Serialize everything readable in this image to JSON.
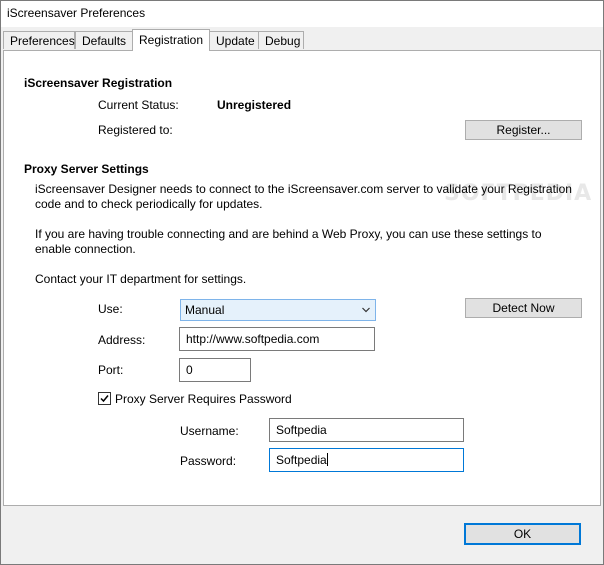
{
  "window": {
    "title": "iScreensaver Preferences"
  },
  "tabs": [
    {
      "label": "Preferences"
    },
    {
      "label": "Defaults"
    },
    {
      "label": "Registration"
    },
    {
      "label": "Update"
    },
    {
      "label": "Debug"
    }
  ],
  "active_tab": "Registration",
  "registration": {
    "heading": "iScreensaver Registration",
    "status_label": "Current Status:",
    "status_value": "Unregistered",
    "registered_to_label": "Registered to:",
    "register_button": "Register..."
  },
  "proxy": {
    "heading": "Proxy Server Settings",
    "desc_line1": "iScreensaver Designer needs to connect to the iScreensaver.com server to validate your Registration",
    "desc_line2": "code and to check periodically for updates.",
    "desc_line3": "If you are having trouble connecting and are behind a Web Proxy, you can use these settings to",
    "desc_line4": "enable connection.",
    "desc_line5": "Contact your IT department for settings.",
    "use_label": "Use:",
    "use_value": "Manual",
    "detect_button": "Detect Now",
    "address_label": "Address:",
    "address_value": "http://www.softpedia.com",
    "port_label": "Port:",
    "port_value": "0",
    "requires_password_label": "Proxy Server Requires Password",
    "requires_password_checked": true,
    "username_label": "Username:",
    "username_value": "Softpedia",
    "password_label": "Password:",
    "password_value": "Softpedia"
  },
  "watermark": "SOFTPEDIA",
  "footer": {
    "ok_button": "OK"
  },
  "colors": {
    "focus": "#0078d7",
    "dropdown_bg": "#e5f1fb"
  }
}
